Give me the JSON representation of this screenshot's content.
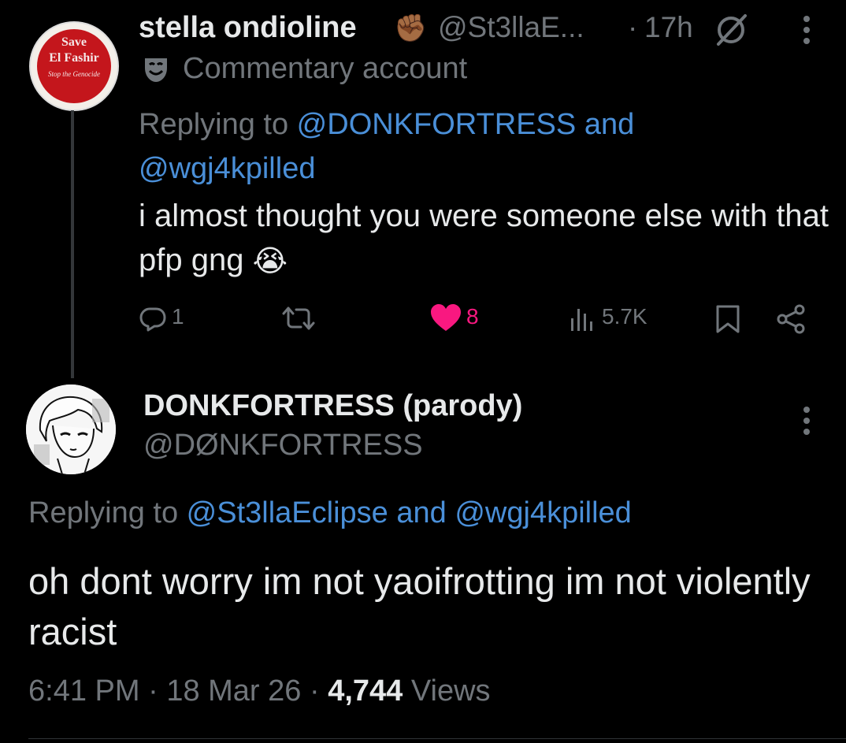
{
  "tweet1": {
    "avatar_text": {
      "line1": "Save",
      "line2": "El Fashir",
      "line3": "Stop the Genocide"
    },
    "name": "stella ondioline",
    "name_emoji": "✊🏾",
    "handle": "@St3llaE...",
    "separator": "·",
    "time": "17h",
    "label_icon": "🎭",
    "label": "Commentary account",
    "replying_prefix": "Replying to ",
    "replying_mention1": "@DONKFORTRESS",
    "replying_and": " and",
    "replying_mention2": "@wgj4kpilled",
    "text": "i almost thought you were someone else with that pfp gng",
    "text_emoji": "😭",
    "actions": {
      "reply_count": "1",
      "retweet_count": "",
      "like_count": "8",
      "views_count": "5.7K"
    },
    "colors": {
      "like": "#f91880",
      "link": "#4a8fd8"
    }
  },
  "tweet2": {
    "name": "DONKFORTRESS (parody)",
    "handle": "@DØNKFORTRESS",
    "replying_prefix": "Replying to ",
    "replying_mention1": "@St3llaEclipse",
    "replying_and": " and ",
    "replying_mention2": "@wgj4kpilled",
    "text": "oh dont worry im not yaoifrotting im not violently racist",
    "time": "6:41 PM",
    "sep1": " · ",
    "date": "18 Mar 26",
    "sep2": " · ",
    "views_count": "4,744",
    "views_label": " Views"
  }
}
